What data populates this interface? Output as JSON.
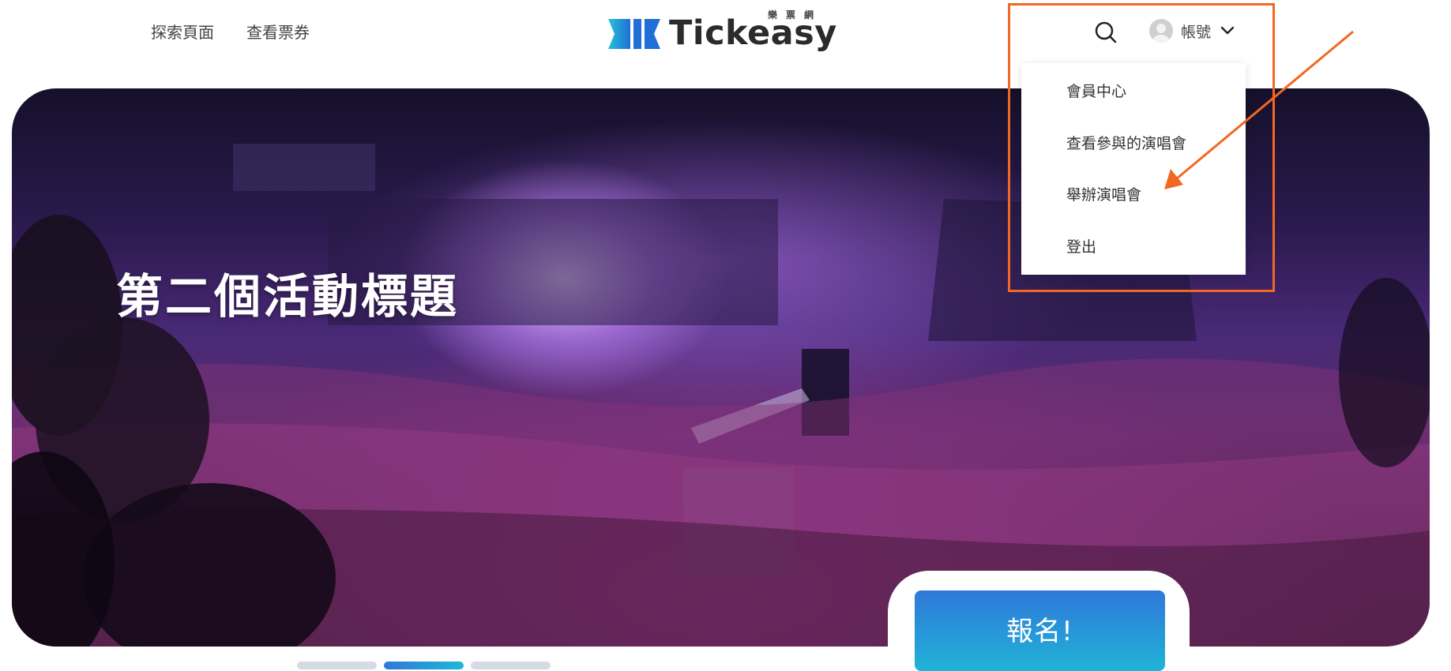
{
  "header": {
    "nav": [
      {
        "label": "探索頁面"
      },
      {
        "label": "查看票券"
      }
    ],
    "logo": {
      "name": "Tickeasy",
      "subtitle": "樂票網",
      "icon": "ticket-logo-icon"
    },
    "search_icon": "search-icon",
    "account": {
      "label": "帳號",
      "avatar_icon": "user-avatar-icon",
      "chevron_icon": "chevron-down-icon"
    }
  },
  "dropdown": {
    "items": [
      {
        "label": "會員中心"
      },
      {
        "label": "查看參與的演唱會"
      },
      {
        "label": "舉辦演唱會"
      },
      {
        "label": "登出"
      }
    ]
  },
  "hero": {
    "title": "第二個活動標題",
    "cta_label": "報名!"
  },
  "carousel": {
    "slide_count": 3,
    "active_index": 1
  },
  "colors": {
    "accent_start": "#2f78d8",
    "accent_end": "#20b8d7",
    "annotation": "#f26722",
    "hero_purple": "#4a2a78"
  }
}
